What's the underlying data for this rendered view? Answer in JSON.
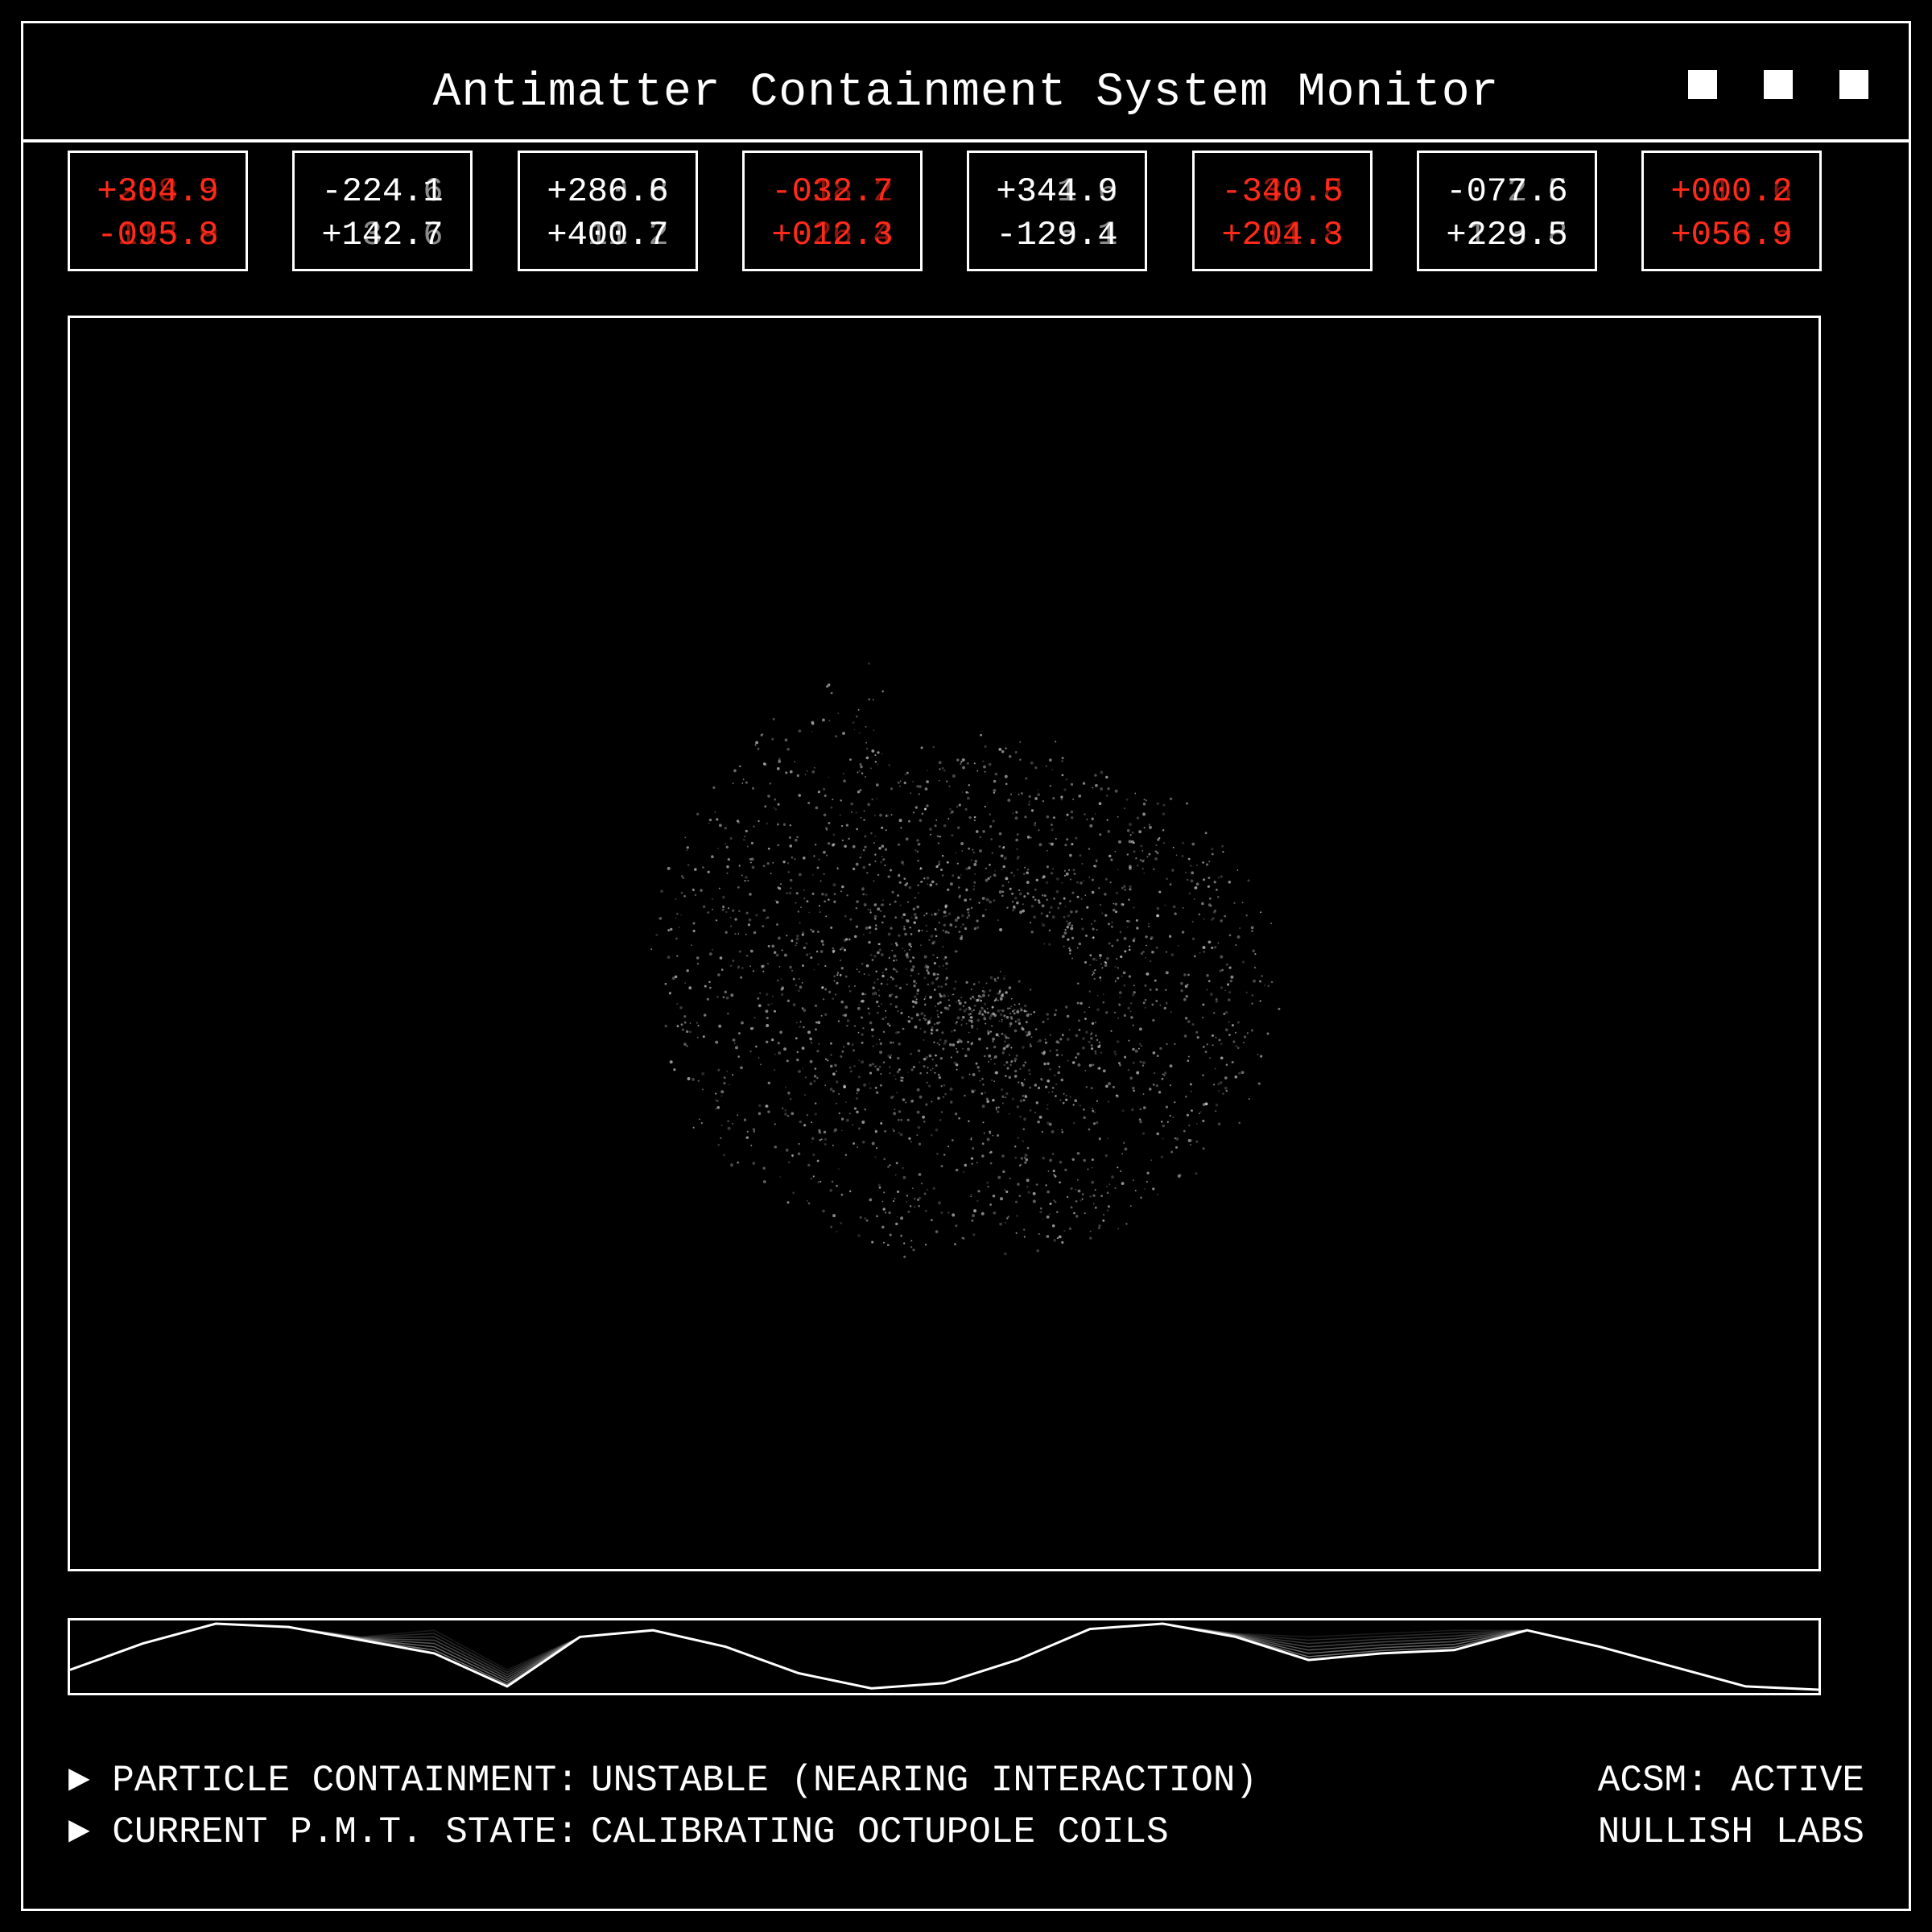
{
  "window": {
    "title": "Antimatter Containment System Monitor",
    "controls": [
      "window-control",
      "window-control",
      "window-control"
    ]
  },
  "readouts": [
    {
      "line1": "+304.9",
      "line1_ghost": "+288.5",
      "line1_color": "red",
      "line2": "-095.8",
      "line2_ghost": "-113.9",
      "line2_color": "red"
    },
    {
      "line1": "-224.1",
      "line1_ghost": "-224.6",
      "line1_color": "white",
      "line2": "+142.7",
      "line2_ghost": "+132.6",
      "line2_color": "white"
    },
    {
      "line1": "+286.6",
      "line1_ghost": "+280.8",
      "line1_color": "white",
      "line2": "+400.7",
      "line2_ghost": "+411.2",
      "line2_color": "white"
    },
    {
      "line1": "-032.7",
      "line1_ghost": "-018.2",
      "line1_color": "red",
      "line2": "+012.3",
      "line2_ghost": "+026.4",
      "line2_color": "red"
    },
    {
      "line1": "+344.9",
      "line1_ghost": "+341.6",
      "line1_color": "white",
      "line2": "-129.4",
      "line2_ghost": "-125.1",
      "line2_color": "white"
    },
    {
      "line1": "-340.5",
      "line1_ghost": "-333.8",
      "line1_color": "red",
      "line2": "+204.3",
      "line2_ghost": "+211.8",
      "line2_color": "red"
    },
    {
      "line1": "-077.6",
      "line1_ghost": "-072.5",
      "line1_color": "white",
      "line2": "+229.5",
      "line2_ghost": "+123.8",
      "line2_color": "white"
    },
    {
      "line1": "+000.2",
      "line1_ghost": "+010.6",
      "line1_color": "red",
      "line2": "+056.9",
      "line2_ghost": "+053.5",
      "line2_color": "red"
    }
  ],
  "viewport": {
    "particle_color": "#ffffff",
    "particle_count": 2600
  },
  "waveform": {
    "values": [
      0.3,
      0.7,
      1.0,
      0.95,
      0.75,
      0.55,
      0.05,
      0.8,
      0.9,
      0.65,
      0.25,
      0.02,
      0.1,
      0.45,
      0.92,
      1.0,
      0.8,
      0.45,
      0.55,
      0.6,
      0.9,
      0.65,
      0.35,
      0.05,
      0.0
    ],
    "trail_values": [
      0.3,
      0.7,
      1.0,
      0.95,
      0.8,
      0.9,
      0.3,
      0.8,
      0.9,
      0.65,
      0.25,
      0.02,
      0.1,
      0.45,
      0.92,
      1.0,
      0.85,
      0.8,
      0.85,
      0.9,
      0.9,
      0.65,
      0.35,
      0.05,
      0.0
    ]
  },
  "status": {
    "line1_label": "► PARTICLE CONTAINMENT:",
    "line1_value": "UNSTABLE (NEARING INTERACTION)",
    "line2_label": "► CURRENT P.M.T. STATE:",
    "line2_value": "CALIBRATING OCTUPOLE COILS"
  },
  "info": {
    "system": "ACSM: ACTIVE",
    "org": "NULLISH LABS"
  },
  "colors": {
    "accent_red": "#ff2a1a",
    "foreground": "#ffffff",
    "background": "#000000"
  }
}
